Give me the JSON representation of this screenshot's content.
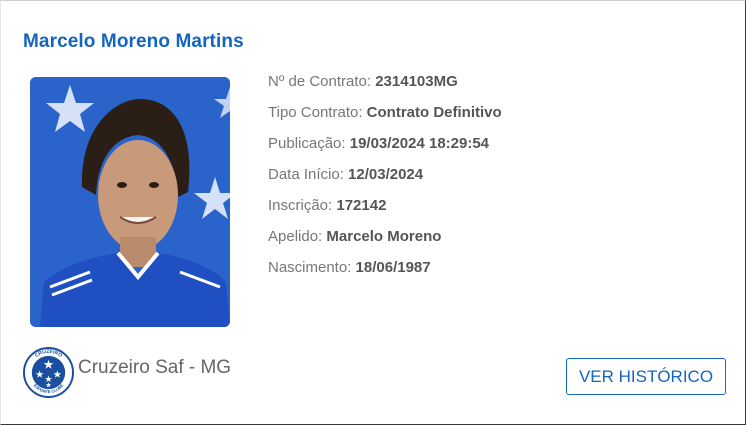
{
  "player": {
    "name": "Marcelo Moreno Martins"
  },
  "details": [
    {
      "label": "Nº de Contrato:",
      "value": "2314103MG"
    },
    {
      "label": "Tipo Contrato:",
      "value": "Contrato Definitivo"
    },
    {
      "label": "Publicação:",
      "value": "19/03/2024 18:29:54"
    },
    {
      "label": "Data Início:",
      "value": "12/03/2024"
    },
    {
      "label": "Inscrição:",
      "value": "172142"
    },
    {
      "label": "Apelido:",
      "value": "Marcelo Moreno"
    },
    {
      "label": "Nascimento:",
      "value": "18/06/1987"
    }
  ],
  "club": {
    "name": "Cruzeiro Saf - MG",
    "crest_icon": "cruzeiro-crest-icon",
    "crest_text": "CRUZEIRO ESPORTE CLUBE"
  },
  "actions": {
    "history_label": "VER HISTÓRICO"
  },
  "colors": {
    "accent": "#1565c0",
    "jersey": "#1f5fc8"
  }
}
